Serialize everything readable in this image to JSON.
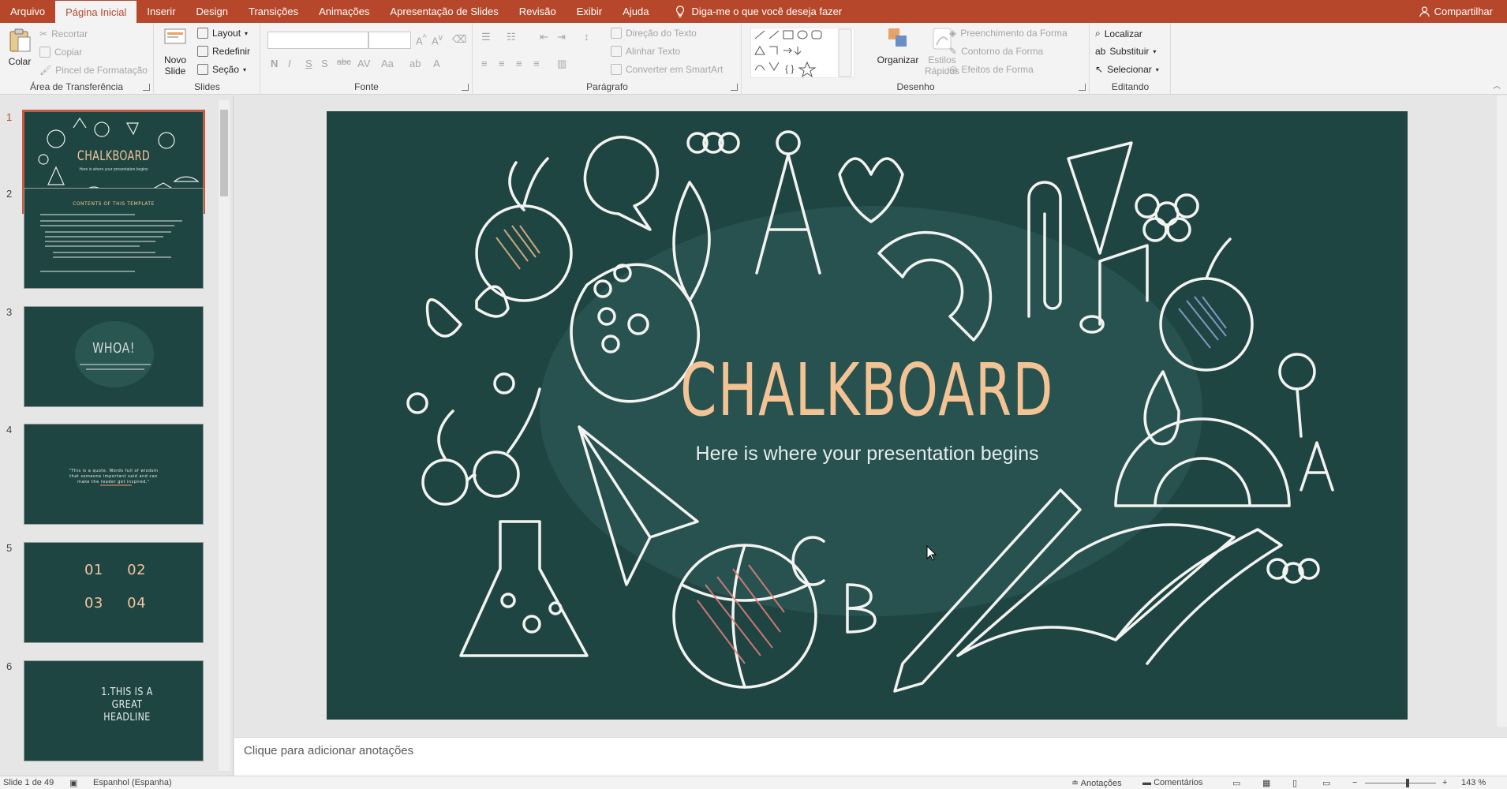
{
  "tabs": [
    "Arquivo",
    "Página Inicial",
    "Inserir",
    "Design",
    "Transições",
    "Animações",
    "Apresentação de Slides",
    "Revisão",
    "Exibir",
    "Ajuda"
  ],
  "tell_me": "Diga-me o que você deseja fazer",
  "share": "Compartilhar",
  "ribbon": {
    "clipboard": {
      "label": "Área de Transferência",
      "paste": "Colar",
      "cut": "Recortar",
      "copy": "Copiar",
      "format_painter": "Pincel de Formatação"
    },
    "slides": {
      "label": "Slides",
      "new_slide_1": "Novo",
      "new_slide_2": "Slide",
      "layout": "Layout",
      "reset": "Redefinir",
      "section": "Seção"
    },
    "font": {
      "label": "Fonte"
    },
    "paragraph": {
      "label": "Parágrafo",
      "text_direction": "Direção do Texto",
      "align_text": "Alinhar Texto",
      "smartart": "Converter em SmartArt"
    },
    "drawing": {
      "label": "Desenho",
      "arrange": "Organizar",
      "quick_styles_1": "Estilos",
      "quick_styles_2": "Rápidos",
      "shape_fill": "Preenchimento da Forma",
      "shape_outline": "Contorno da Forma",
      "shape_effects": "Efeitos de Forma"
    },
    "editing": {
      "label": "Editando",
      "find": "Localizar",
      "replace": "Substituir",
      "select": "Selecionar"
    }
  },
  "thumbnails": [
    {
      "num": "1",
      "title": "CHALKBOARD",
      "sub": "Here is where your presentation begins"
    },
    {
      "num": "2",
      "title": "CONTENTS OF THIS TEMPLATE"
    },
    {
      "num": "3",
      "title": "WHOA!"
    },
    {
      "num": "4",
      "title": "\"This is a quote. Words full of wisdom that someone important said and can make the reader get inspired.\""
    },
    {
      "num": "5",
      "title": "01  02  03  04"
    },
    {
      "num": "6",
      "title": "1.THIS IS A GREAT HEADLINE"
    }
  ],
  "slide": {
    "title": "CHALKBOARD",
    "subtitle": "Here is where your presentation begins"
  },
  "notes_placeholder": "Clique para adicionar anotações",
  "status": {
    "slide_of": "Slide 1 de 49",
    "language": "Espanhol (Espanha)",
    "notes": "Anotações",
    "comments": "Comentários",
    "zoom": "143 %"
  },
  "colors": {
    "accent": "#b7472a",
    "slide_bg": "#1f4543",
    "title": "#f4c394"
  }
}
